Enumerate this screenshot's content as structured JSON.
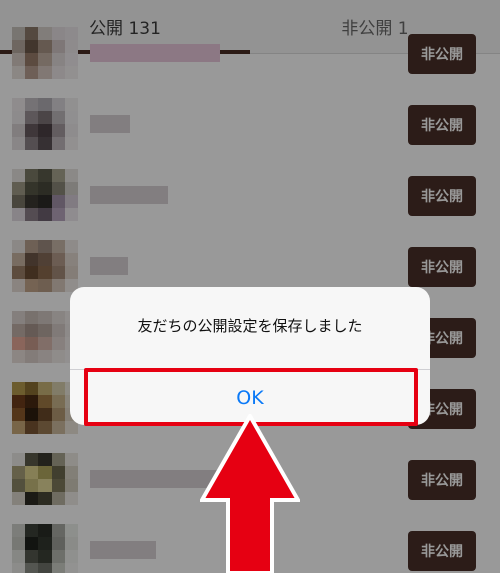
{
  "tabs": [
    {
      "label": "公開 131",
      "active": true
    },
    {
      "label": "非公開 1",
      "active": false
    }
  ],
  "friend_list": {
    "button_label": "非公開",
    "names_pixelated": true
  },
  "dialog": {
    "message": "友だちの公開設定を保存しました",
    "ok_label": "OK"
  },
  "colors": {
    "tab_underline": "#4a2e25",
    "button_bg": "#4a3028",
    "dialog_ok_text": "#0a79f7",
    "annotation_red": "#e60012"
  }
}
